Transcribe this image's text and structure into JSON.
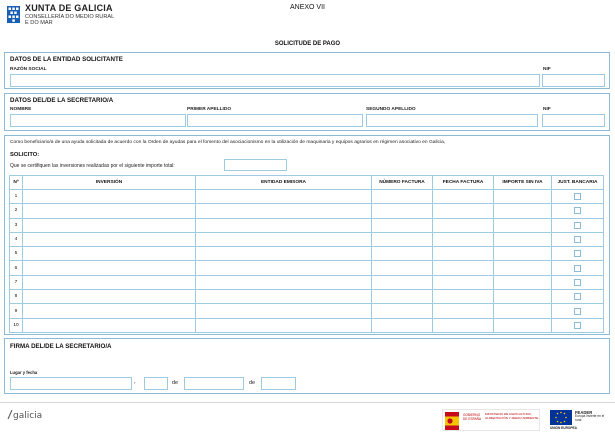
{
  "header": {
    "logo_title": "XUNTA DE GALICIA",
    "logo_line1": "CONSELLERÍA DO MEDIO RURAL",
    "logo_line2": "E DO MAR",
    "annex": "ANEXO VII",
    "doc_title": "SOLICITUDE DE PAGO"
  },
  "entidad": {
    "title": "DATOS DE LA ENTIDAD SOLICITANTE",
    "razon_label": "RAZÓN SOCIAL",
    "nif_label": "NIF"
  },
  "secretario": {
    "title": "DATOS DEL/DE LA SECRETARIO/A",
    "nombre_label": "NOMBRE",
    "apellido1_label": "PRIMER APELLIDO",
    "apellido2_label": "SEGUNDO APELLIDO",
    "nif_label": "NIF"
  },
  "solicito": {
    "intro": "Como beneficiario/a de una ayuda solicitada de acuerdo con la Orden de ayudas para el fomento del asociacionismo en la utilización de maquinaria y equipos agrarios en régimen asociativo en Galicia,",
    "title": "SOLICITO:",
    "importe_text": "Que se certifiquen las inversiones realizadas por el siguiente importe total:"
  },
  "table": {
    "headers": [
      "Nº",
      "INVERSIÓN",
      "ENTIDAD EMISORA",
      "NÚMERO FACTURA",
      "FECHA FACTURA",
      "IMPORTE SIN IVA",
      "JUST. BANCARIA"
    ],
    "rows": [
      "1",
      "2",
      "3",
      "4",
      "5",
      "6",
      "7",
      "8",
      "9",
      "10"
    ]
  },
  "firma": {
    "title": "FIRMA DEL/DE LA SECRETARIO/A",
    "lugar_label": "Lugar y fecha",
    "comma": ",",
    "de1": "de",
    "de2": "de"
  },
  "footer": {
    "galicia": "galicia",
    "ministry_top": "GOBIERNO DE ESPAÑA",
    "ministry_name": "MINISTERIO DE AGRICULTURA, ALIMENTACIÓN Y MEDIO AMBIENTE",
    "feader_title": "FEADER",
    "feader_sub": "Europa invierte en el rural",
    "eu_label": "UNIÓN EUROPEA"
  },
  "colors": {
    "border": "#8bbcd6",
    "xunta_blue": "#1a5fb4"
  }
}
